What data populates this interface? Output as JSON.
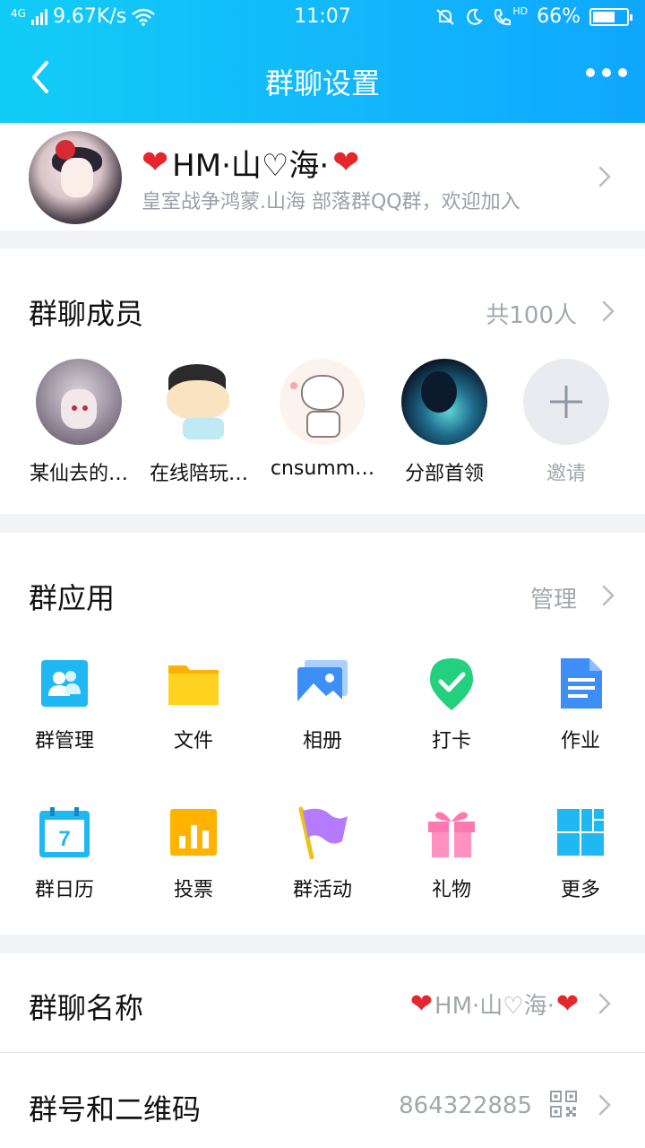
{
  "status_bar": {
    "network": "4G",
    "speed": "9.67K/s",
    "time": "11:07",
    "battery": "66%",
    "battery_level": 0.66,
    "hd": "HD"
  },
  "nav": {
    "title": "群聊设置"
  },
  "group": {
    "name_left_heart": "❤",
    "name_text": "HM·山♡海·",
    "name_right_heart": "❤",
    "description": "皇室战争鸿蒙.山海 部落群QQ群，欢迎加入"
  },
  "members": {
    "title": "群聊成员",
    "count": "共100人",
    "items": [
      {
        "name": "某仙去的…"
      },
      {
        "name": "在线陪玩…"
      },
      {
        "name": "cnsumm…"
      },
      {
        "name": "分部首领"
      },
      {
        "name": "邀请",
        "icon": "plus-icon"
      }
    ]
  },
  "apps": {
    "title": "群应用",
    "manage": "管理",
    "items": [
      {
        "label": "群管理",
        "icon": "group-manage-icon",
        "color": "#1fb8f3"
      },
      {
        "label": "文件",
        "icon": "folder-icon",
        "color": "#ffc107"
      },
      {
        "label": "相册",
        "icon": "album-icon",
        "color": "#3d8ff5"
      },
      {
        "label": "打卡",
        "icon": "checkin-icon",
        "color": "#23d07d"
      },
      {
        "label": "作业",
        "icon": "homework-icon",
        "color": "#3e8ef7"
      },
      {
        "label": "群日历",
        "icon": "calendar-icon",
        "color": "#1fb8f3",
        "day": "7"
      },
      {
        "label": "投票",
        "icon": "vote-icon",
        "color": "#ffb300"
      },
      {
        "label": "群活动",
        "icon": "flag-icon",
        "color": "#b57bff"
      },
      {
        "label": "礼物",
        "icon": "gift-icon",
        "color": "#ff79b0"
      },
      {
        "label": "更多",
        "icon": "more-grid-icon",
        "color": "#1fb8f3"
      }
    ]
  },
  "rows": {
    "group_name": {
      "label": "群聊名称",
      "value_left_heart": "❤",
      "value_text": "HM·山♡海·",
      "value_right_heart": "❤"
    },
    "group_id": {
      "label": "群号和二维码",
      "value": "864322885"
    }
  }
}
